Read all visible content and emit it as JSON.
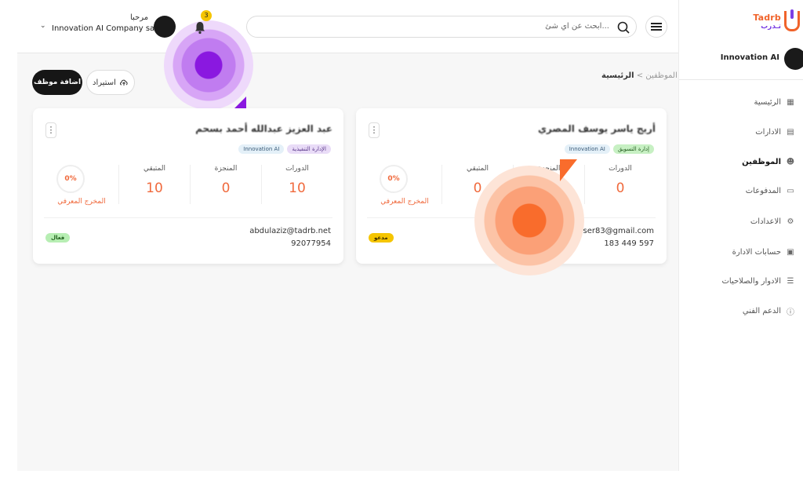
{
  "sidebar": {
    "logo_en": "Tadrb",
    "logo_ar": "تـدرب",
    "org_name": "Innovation AI",
    "items": [
      {
        "label": "الرئيسية",
        "icon": "grid-icon"
      },
      {
        "label": "الادارات",
        "icon": "building-icon"
      },
      {
        "label": "الموظفين",
        "icon": "users-icon",
        "active": true
      },
      {
        "label": "المدفوعات",
        "icon": "wallet-icon"
      },
      {
        "label": "الاعدادات",
        "icon": "gear-icon"
      },
      {
        "label": "حسابات الادارة",
        "icon": "user-card-icon"
      },
      {
        "label": "الادوار والصلاحيات",
        "icon": "list-check-icon"
      },
      {
        "label": "الدعم الفني",
        "icon": "help-icon"
      }
    ]
  },
  "header": {
    "search_placeholder": "ابحث عن اي شئ...",
    "notification_count": "3",
    "greeting": "مرحبا",
    "company": "Innovation AI Company sa"
  },
  "breadcrumb": {
    "home": "الرئيسية",
    "separator": ">",
    "current": "الموظفين"
  },
  "actions": {
    "add_label": "اضافة موظف",
    "import_label": "استيراد"
  },
  "employees": [
    {
      "name": "أريج ياسر يوسف المصري",
      "department": "إدارة التسويق",
      "company": "Innovation AI",
      "stats": [
        {
          "label": "الدورات",
          "value": "0"
        },
        {
          "label": "المنجزة",
          "value": "0"
        },
        {
          "label": "المتبقي",
          "value": "0"
        }
      ],
      "progress": "0%",
      "progress_label": "المخرج المعرفي",
      "email": "Areejyaser83@gmail.com",
      "phone": "183 449 597",
      "status": "مدعو"
    },
    {
      "name": "عبد العزيز عبدالله أحمد بسحم",
      "department": "الإدارة التنفيذية",
      "company": "Innovation AI",
      "stats": [
        {
          "label": "الدورات",
          "value": "10"
        },
        {
          "label": "المنجزة",
          "value": "0"
        },
        {
          "label": "المتبقي",
          "value": "10"
        }
      ],
      "progress": "0%",
      "progress_label": "المخرج المعرفي",
      "email": "abdulaziz@tadrb.net",
      "phone": "92077954",
      "status": "فعال"
    }
  ],
  "colors": {
    "accent_orange": "#f06a3d",
    "brand_purple": "#7b3fe4",
    "badge_yellow": "#f5c500",
    "active_green": "#b7eeb3"
  }
}
